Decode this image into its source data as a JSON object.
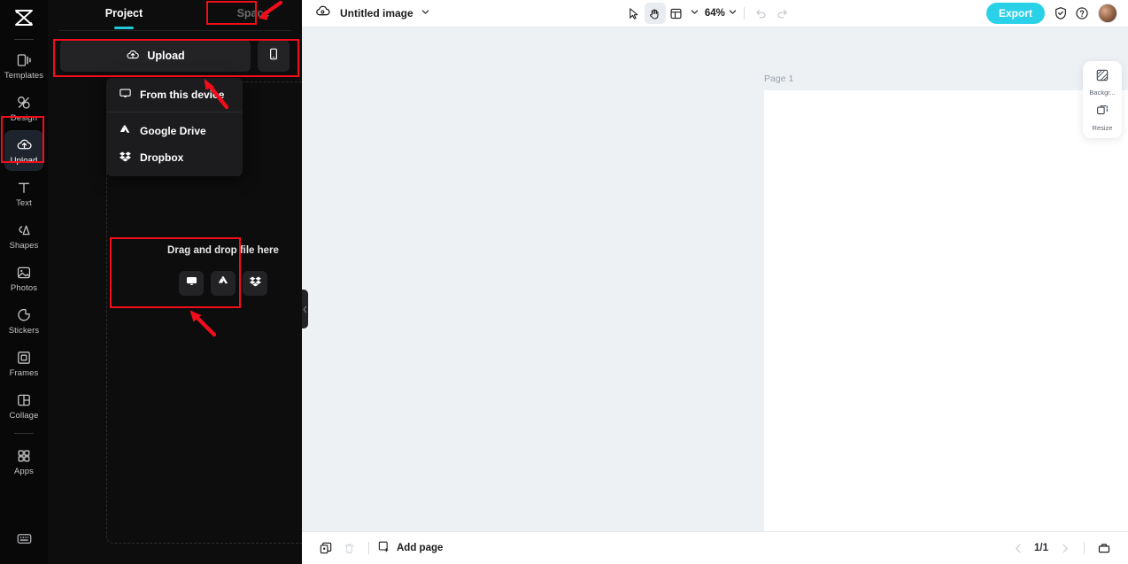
{
  "rail": {
    "logo": "capcut-logo",
    "items": [
      {
        "label": "Templates",
        "icon": "templates-icon",
        "active": false
      },
      {
        "label": "Design",
        "icon": "design-icon",
        "active": false
      },
      {
        "label": "Upload",
        "icon": "upload-cloud-icon",
        "active": true
      },
      {
        "label": "Text",
        "icon": "text-icon",
        "active": false
      },
      {
        "label": "Shapes",
        "icon": "shapes-icon",
        "active": false
      },
      {
        "label": "Photos",
        "icon": "photos-icon",
        "active": false
      },
      {
        "label": "Stickers",
        "icon": "stickers-icon",
        "active": false
      },
      {
        "label": "Frames",
        "icon": "frames-icon",
        "active": false
      },
      {
        "label": "Collage",
        "icon": "collage-icon",
        "active": false
      },
      {
        "label": "Apps",
        "icon": "apps-grid-icon",
        "active": false
      }
    ],
    "bottom_icon": "keyboard-shortcuts-icon"
  },
  "panel": {
    "tabs": [
      {
        "label": "Project",
        "active": true
      },
      {
        "label": "Space",
        "active": false
      }
    ],
    "upload_label": "Upload",
    "upload_icon": "upload-cloud-icon",
    "mobile_icon": "mobile-phone-icon",
    "menu": [
      {
        "label": "From this device",
        "icon": "monitor-icon"
      },
      {
        "label": "Google Drive",
        "icon": "google-drive-icon"
      },
      {
        "label": "Dropbox",
        "icon": "dropbox-icon"
      }
    ],
    "dropzone": {
      "title": "Drag and drop file here",
      "icons": [
        "monitor-icon",
        "google-drive-icon",
        "dropbox-icon"
      ]
    }
  },
  "topbar": {
    "brand_icon": "cloud-logo-icon",
    "title": "Untitled image",
    "title_chevron": "chevron-down-icon",
    "tools": [
      {
        "name": "cursor-select-tool",
        "selected": false
      },
      {
        "name": "hand-pan-tool",
        "selected": true
      },
      {
        "name": "layout-grid-tool",
        "selected": false
      }
    ],
    "zoom_level": "64%",
    "undo_icon": "undo-icon",
    "redo_icon": "redo-icon",
    "export_label": "Export",
    "shield_icon": "shield-check-icon",
    "help_icon": "help-circle-icon",
    "avatar": "user-avatar"
  },
  "canvas": {
    "page_label": "Page 1",
    "tools": [
      {
        "name": "page-lock-icon"
      },
      {
        "name": "page-more-options-icon"
      }
    ]
  },
  "right_card": {
    "items": [
      {
        "label": "Backgr...",
        "icon": "background-icon"
      },
      {
        "label": "Resize",
        "icon": "resize-icon"
      }
    ]
  },
  "bottombar": {
    "duplicate_icon": "duplicate-page-icon",
    "delete_icon": "trash-icon",
    "add_page_label": "Add page",
    "add_page_icon": "add-page-icon",
    "prev_icon": "chevron-left-icon",
    "page_indicator": "1/1",
    "next_icon": "chevron-right-icon",
    "grid_view_icon": "page-grid-view-icon"
  },
  "annotations": {
    "accent_color": "#f20d1a",
    "boxes": [
      "space-tab-highlight",
      "upload-row-highlight",
      "upload-rail-item-highlight",
      "dropzone-highlight"
    ],
    "arrows": [
      "arrow-to-space-tab",
      "arrow-to-upload-menu",
      "arrow-to-dropzone"
    ]
  },
  "colors": {
    "accent_cyan": "#2ad1e8",
    "tab_underline": "#22c8d8",
    "rail_bg": "#080808",
    "panel_bg": "#0d0d0d",
    "canvas_bg": "#eef1f4",
    "annotation_red": "#f20d1a"
  }
}
